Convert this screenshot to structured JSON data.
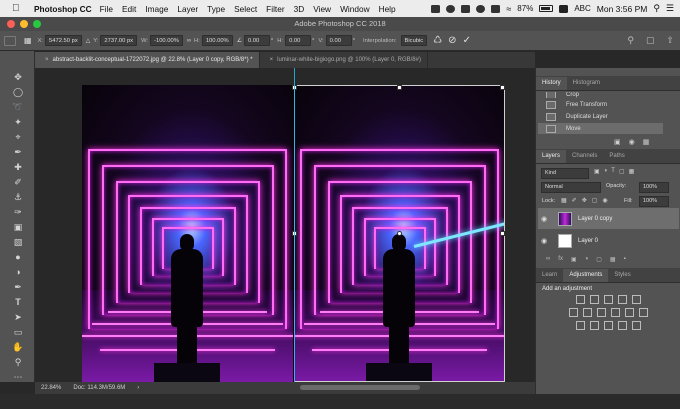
{
  "menubar": {
    "app_name": "Photoshop CC",
    "items": [
      "File",
      "Edit",
      "Image",
      "Layer",
      "Type",
      "Select",
      "Filter",
      "3D",
      "View",
      "Window",
      "Help"
    ],
    "battery": "87%",
    "input_source": "ABC",
    "clock": "Mon 3:56 PM"
  },
  "window": {
    "title": "Adobe Photoshop CC 2018"
  },
  "options": {
    "x_label": "X:",
    "x_value": "5472.50 px",
    "y_label": "Y:",
    "y_value": "2737.00 px",
    "w_label": "W:",
    "w_value": "-100.00%",
    "h_label": "H:",
    "h_value": "100.00%",
    "angle_value": "0.00",
    "hskew_label": "H:",
    "hskew_value": "0.00",
    "vskew_label": "V:",
    "vskew_value": "0.00",
    "interpolation_label": "Interpolation:",
    "interpolation_value": "Bicubic"
  },
  "tabs": [
    {
      "label": "abstract-backlit-conceptual-1722072.jpg @ 22.8% (Layer 0 copy, RGB/8*) *",
      "active": true
    },
    {
      "label": "luminar-white-bigiogo.png @ 100% (Layer 0, RGB/8#)",
      "active": false
    }
  ],
  "status": {
    "zoom": "22.84%",
    "doc": "Doc: 114.3M/59.6M"
  },
  "history": {
    "tabs": [
      "History",
      "Histogram"
    ],
    "items": [
      {
        "label": "Crop",
        "selected": false
      },
      {
        "label": "Free Transform",
        "selected": false
      },
      {
        "label": "Duplicate Layer",
        "selected": false
      },
      {
        "label": "Move",
        "selected": true
      }
    ]
  },
  "layers": {
    "tabs": [
      "Layers",
      "Channels",
      "Paths"
    ],
    "filter_placeholder": "Kind",
    "blend_mode": "Normal",
    "opacity_label": "Opacity:",
    "opacity_value": "100%",
    "lock_label": "Lock:",
    "fill_label": "Fill:",
    "fill_value": "100%",
    "items": [
      {
        "name": "Layer 0 copy",
        "selected": true
      },
      {
        "name": "Layer 0",
        "selected": false
      }
    ]
  },
  "adjustments": {
    "tabs": [
      "Learn",
      "Adjustments",
      "Styles"
    ],
    "heading": "Add an adjustment"
  },
  "colors": {
    "accent_guide": "#22b3e3",
    "neon": "#ff6cf4",
    "traffic_red": "#fc5f57",
    "traffic_yellow": "#fdbc2e",
    "traffic_green": "#28c840"
  }
}
